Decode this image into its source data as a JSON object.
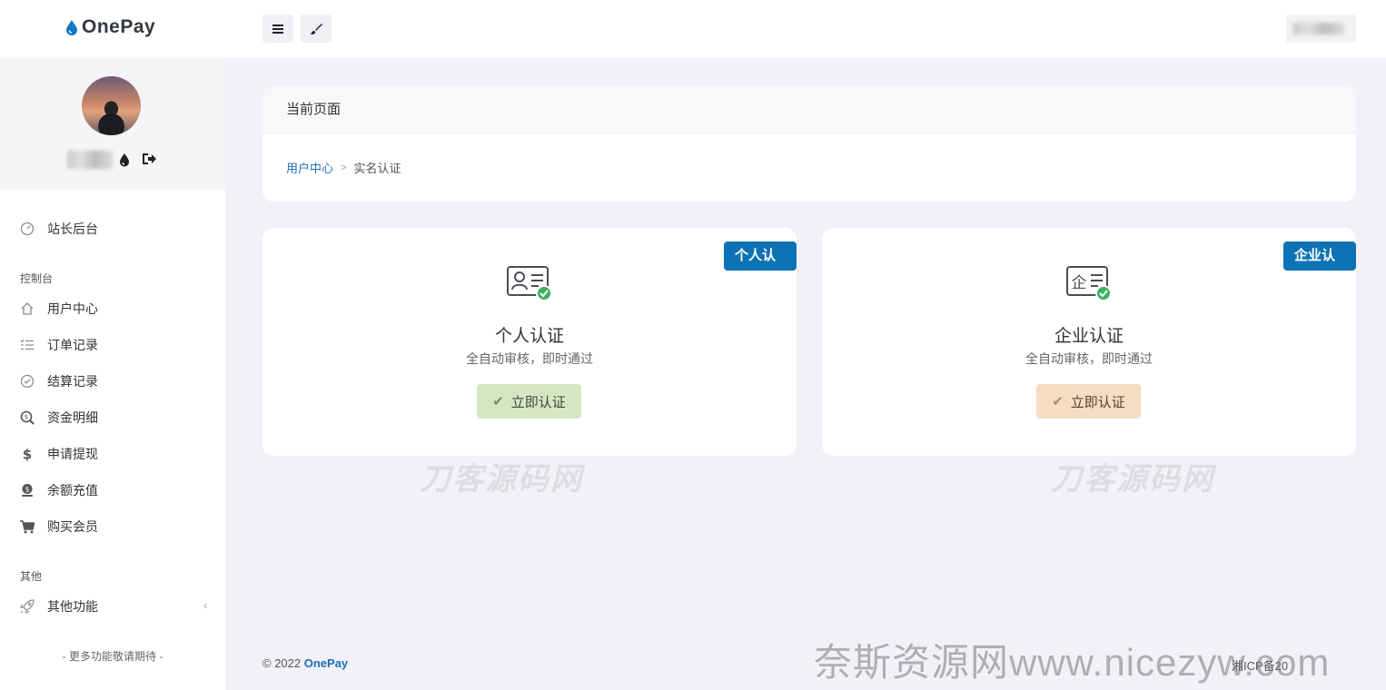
{
  "header": {
    "brand": "OnePay",
    "menu_icon": "menu-icon",
    "theme_icon": "brush-icon"
  },
  "sidebar": {
    "profile": {
      "drop_icon": "drop-icon",
      "logout_icon": "logout-icon"
    },
    "admin_item": {
      "label": "站长后台",
      "icon": "dashboard-icon"
    },
    "sections": [
      {
        "title": "控制台",
        "items": [
          {
            "label": "用户中心",
            "icon": "home-icon"
          },
          {
            "label": "订单记录",
            "icon": "list-icon"
          },
          {
            "label": "结算记录",
            "icon": "check-circle-icon"
          },
          {
            "label": "资金明细",
            "icon": "search-money-icon"
          },
          {
            "label": "申请提现",
            "icon": "dollar-icon"
          },
          {
            "label": "余额充值",
            "icon": "coin-icon"
          },
          {
            "label": "购买会员",
            "icon": "cart-icon"
          }
        ]
      },
      {
        "title": "其他",
        "items": [
          {
            "label": "其他功能",
            "icon": "rocket-icon"
          }
        ]
      }
    ],
    "footer": "- 更多功能敬请期待 -"
  },
  "breadcrumb_card": {
    "title": "当前页面",
    "home": "用户中心",
    "separator": ">",
    "current": "实名认证"
  },
  "cards": [
    {
      "ribbon": "个人认证",
      "title": "个人认证",
      "subtitle": "全自动审核，即时通过",
      "button": "立即认证",
      "icon": "id-card-person-icon",
      "button_color": "#d6e6c4"
    },
    {
      "ribbon": "企业认证",
      "title": "企业认证",
      "subtitle": "全自动审核，即时通过",
      "button": "立即认证",
      "icon": "id-card-enterprise-icon",
      "button_color": "#f6dcc0"
    }
  ],
  "watermarks": [
    "刀客源码网",
    "刀客源码网"
  ],
  "footer": {
    "copyright": "© 2022",
    "brand": "OnePay",
    "icp": "湘ICP备20"
  },
  "overlay_watermark": "奈斯资源网www.nicezyw.com",
  "colors": {
    "accent": "#0e73b5",
    "link": "#1d6fb8",
    "page_bg": "#f1f2f7"
  }
}
